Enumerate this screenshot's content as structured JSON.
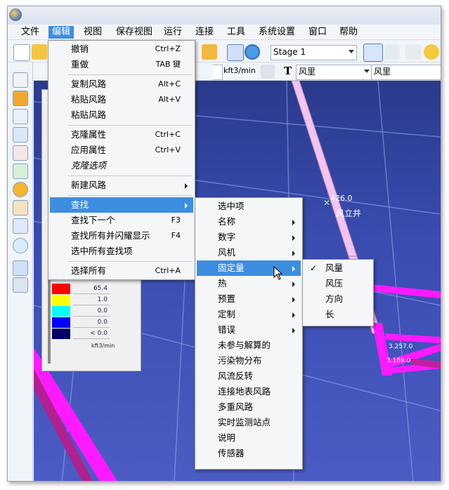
{
  "menubar": {
    "items": [
      {
        "label": "文件"
      },
      {
        "label": "编辑"
      },
      {
        "label": "视图"
      },
      {
        "label": "保存视图"
      },
      {
        "label": "运行"
      },
      {
        "label": "连接"
      },
      {
        "label": "工具"
      },
      {
        "label": "系统设置"
      },
      {
        "label": "窗口"
      },
      {
        "label": "帮助"
      }
    ]
  },
  "toolbar": {
    "stage_select": "Stage 1",
    "unit_label": "kft3/min",
    "text_tool_glyph": "T",
    "font_select": "风里",
    "field_select": "风里"
  },
  "edit_menu": {
    "items": [
      {
        "label": "撤销",
        "shortcut": "Ctrl+Z"
      },
      {
        "label": "重做",
        "shortcut": "TAB 键"
      },
      {
        "label": "复制风路",
        "shortcut": "Alt+C"
      },
      {
        "label": "粘贴风路",
        "shortcut": "Alt+V"
      },
      {
        "label": "粘贴风路",
        "shortcut": ""
      },
      {
        "label": "克隆属性",
        "shortcut": "Ctrl+C"
      },
      {
        "label": "应用属性",
        "shortcut": "Ctrl+V"
      },
      {
        "label": "克隆选项",
        "shortcut": ""
      },
      {
        "label": "新建风路",
        "shortcut": ""
      },
      {
        "label": "查找",
        "shortcut": ""
      },
      {
        "label": "查找下一个",
        "shortcut": "F3"
      },
      {
        "label": "查找所有并闪耀显示",
        "shortcut": "F4"
      },
      {
        "label": "选中所有查找项",
        "shortcut": ""
      },
      {
        "label": "选择所有",
        "shortcut": "Ctrl+A"
      }
    ]
  },
  "find_menu": {
    "items": [
      {
        "label": "选中项"
      },
      {
        "label": "名称"
      },
      {
        "label": "数字"
      },
      {
        "label": "风机"
      },
      {
        "label": "固定量"
      },
      {
        "label": "热"
      },
      {
        "label": "预置"
      },
      {
        "label": "定制"
      },
      {
        "label": "错误"
      },
      {
        "label": "未参与解算的"
      },
      {
        "label": "污染物分布"
      },
      {
        "label": "风流反转"
      },
      {
        "label": "连接地表风路"
      },
      {
        "label": "多重风路"
      },
      {
        "label": "实时监测站点"
      },
      {
        "label": "说明"
      },
      {
        "label": "传感器"
      }
    ]
  },
  "fixed_menu": {
    "items": [
      {
        "label": "风量",
        "checked": "✓"
      },
      {
        "label": "风压",
        "checked": ""
      },
      {
        "label": "方向",
        "checked": ""
      },
      {
        "label": "长",
        "checked": ""
      }
    ]
  },
  "legend": {
    "values": [
      "65.4",
      "1.0",
      "0.0",
      "0.0",
      "< 0.0"
    ],
    "unit": "kft3/min",
    "colors": [
      "#ffff00",
      "#00ffff",
      "#0000ff",
      "#000066"
    ]
  },
  "scene": {
    "shaft_value": "426.0",
    "shaft_name": "风立井",
    "value_2": "3.257.0",
    "value_3": "3.169.0"
  },
  "colors": {
    "accent": "#3d8ee0",
    "airway_magenta": "#ff1aff",
    "shaft_pink": "#f2c4f0",
    "viewport_blue": "#3a4cb0"
  }
}
